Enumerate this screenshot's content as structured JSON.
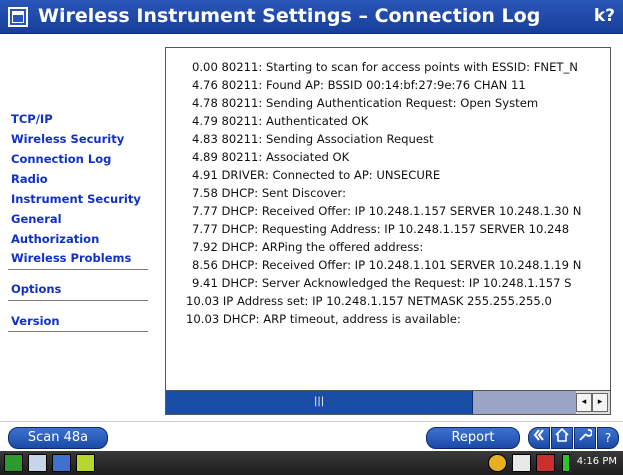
{
  "window": {
    "title": "Wireless Instrument Settings – Connection Log",
    "help_glyph": "k?"
  },
  "sidebar": {
    "items": [
      {
        "label": "TCP/IP"
      },
      {
        "label": "Wireless Security"
      },
      {
        "label": "Connection Log"
      },
      {
        "label": "Radio"
      },
      {
        "label": "Instrument Security"
      },
      {
        "label": "General"
      },
      {
        "label": "Authorization"
      },
      {
        "label": "Wireless Problems"
      },
      {
        "label": "Options"
      },
      {
        "label": "Version"
      }
    ]
  },
  "log": {
    "lines": [
      "0.00 80211: Starting to scan for access points with ESSID: FNET_N",
      "4.76 80211: Found AP: BSSID 00:14:bf:27:9e:76  CHAN 11",
      "4.78 80211: Sending Authentication Request: Open System",
      "4.79 80211: Authenticated OK",
      "4.83 80211: Sending Association Request",
      "4.89 80211: Associated OK",
      "4.91 DRIVER: Connected to AP: UNSECURE",
      "7.58 DHCP: Sent Discover:",
      "7.77 DHCP: Received Offer: IP 10.248.1.157 SERVER 10.248.1.30 N",
      "7.77 DHCP: Requesting Address: IP 10.248.1.157  SERVER 10.248",
      "7.92 DHCP: ARPing the offered address:",
      "8.56 DHCP: Received Offer: IP 10.248.1.101 SERVER 10.248.1.19 N",
      "9.41 DHCP: Server Acknowledged the Request: IP 10.248.1.157  S",
      "10.03 IP Address set: IP 10.248.1.157  NETMASK 255.255.255.0",
      "10.03 DHCP: ARP timeout, address is available:"
    ]
  },
  "scrollbar": {
    "grip": "|||",
    "left_arrow": "◂",
    "right_arrow": "▸"
  },
  "buttons": {
    "scan": "Scan 48a",
    "report": "Report"
  },
  "taskbar": {
    "clock": "4:16 PM"
  },
  "colors": {
    "title_bar": "#1f4ba6",
    "nav_link": "#1030c8",
    "button": "#1a4aa8"
  }
}
